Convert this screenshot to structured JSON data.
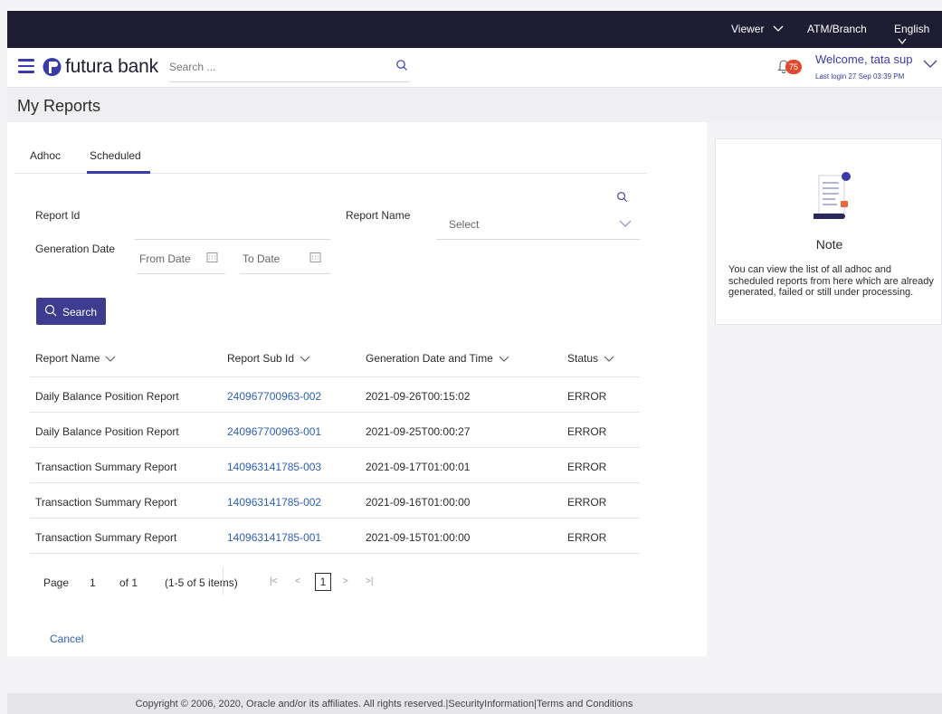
{
  "topbar": {
    "role": "Viewer",
    "location": "ATM/Branch",
    "language": "English"
  },
  "header": {
    "brand": "futura bank",
    "search_placeholder": "Search ...",
    "notification_count": "75",
    "welcome": "Welcome, tata sup",
    "last_login": "Last login 27 Sep 03:39 PM"
  },
  "page": {
    "title": "My Reports"
  },
  "tabs": [
    {
      "label": "Adhoc"
    },
    {
      "label": "Scheduled"
    }
  ],
  "filters": {
    "report_id_label": "Report Id",
    "report_name_label": "Report Name",
    "report_name_value": "Select",
    "generation_date_label": "Generation Date",
    "from_date_label": "From Date",
    "to_date_label": "To Date",
    "search_button": "Search"
  },
  "table": {
    "columns": [
      "Report Name",
      "Report Sub Id",
      "Generation Date and Time",
      "Status"
    ],
    "rows": [
      {
        "name": "Daily Balance Position Report",
        "sub_id": "240967700963-002",
        "datetime": "2021-09-26T00:15:02",
        "status": "ERROR"
      },
      {
        "name": "Daily Balance Position Report",
        "sub_id": "240967700963-001",
        "datetime": "2021-09-25T00:00:27",
        "status": "ERROR"
      },
      {
        "name": "Transaction Summary Report",
        "sub_id": "140963141785-003",
        "datetime": "2021-09-17T01:00:01",
        "status": "ERROR"
      },
      {
        "name": "Transaction Summary Report",
        "sub_id": "140963141785-002",
        "datetime": "2021-09-16T01:00:00",
        "status": "ERROR"
      },
      {
        "name": "Transaction Summary Report",
        "sub_id": "140963141785-001",
        "datetime": "2021-09-15T01:00:00",
        "status": "ERROR"
      }
    ]
  },
  "pagination": {
    "page_label": "Page",
    "page": "1",
    "of_label": "of 1",
    "items": "(1-5 of 5 items)",
    "current": "1",
    "first": "|<",
    "prev": "<",
    "next": ">",
    "last": ">|"
  },
  "cancel_label": "Cancel",
  "note": {
    "title": "Note",
    "text": "You can view the list of all adhoc and scheduled reports from here which are already generated, failed or still under processing."
  },
  "footer": {
    "text": "Copyright © 2006, 2020, Oracle and/or its affiliates. All rights reserved.|SecurityInformation|Terms and Conditions"
  },
  "colors": {
    "topbar": "#1e1d33",
    "primary": "#3d3c8f",
    "link": "#2d5fb8",
    "badge": "#e0492d"
  }
}
